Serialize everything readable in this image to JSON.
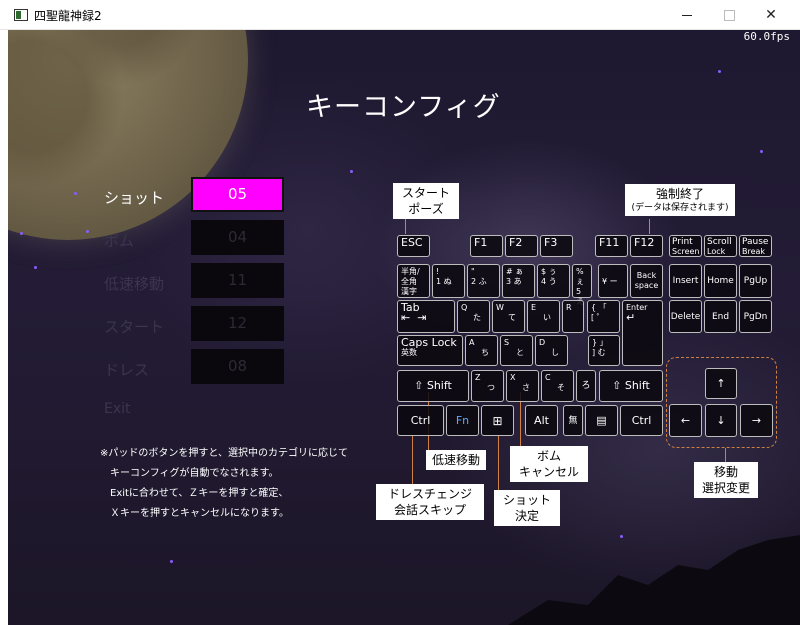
{
  "window": {
    "title": "四聖龍神録2"
  },
  "hud": {
    "fps": "60.0fps"
  },
  "page": {
    "title": "キーコンフィグ"
  },
  "menu": {
    "items": [
      {
        "label": "ショット",
        "value": "05",
        "active": true
      },
      {
        "label": "ボム",
        "value": "04",
        "active": false
      },
      {
        "label": "低速移動",
        "value": "11",
        "active": false
      },
      {
        "label": "スタート",
        "value": "12",
        "active": false
      },
      {
        "label": "ドレス",
        "value": "08",
        "active": false
      }
    ],
    "exit_label": "Exit"
  },
  "note": {
    "lines": [
      "※パッドのボタンを押すと、選択中のカテゴリに応じて",
      "　キーコンフィグが自動でなされます。",
      "　Exitに合わせて、Ｚキーを押すと確定、",
      "　Ｘキーを押すとキャンセルになります。"
    ]
  },
  "keyboard": {
    "esc": "ESC",
    "f1": "F1",
    "f2": "F2",
    "f3": "F3",
    "f11": "F11",
    "f12": "F12",
    "print": "Print",
    "print2": "Screen",
    "scroll": "Scroll",
    "scroll2": "Lock",
    "pause": "Pause",
    "pause2": "Break",
    "hankaku": "半角/",
    "zenkaku": "全角",
    "kanji": "漢字",
    "k1a": "!",
    "k1b": "1 ぬ",
    "k2a": "\"",
    "k2b": "2 ふ",
    "k3a": "# ぁ",
    "k3b": "3 あ",
    "k4a": "$ ぅ",
    "k4b": "4 う",
    "k5a": "% ぇ",
    "k5b": "5 え",
    "yen": "¥ ー",
    "backspace1": "Back",
    "backspace2": "space",
    "insert": "Insert",
    "home": "Home",
    "pgup": "PgUp",
    "tab": "Tab",
    "q1": "Q",
    "q2": "た",
    "w1": "W",
    "w2": "て",
    "e1": "E",
    "e2": "い",
    "r1": "R",
    "br1": "{ 「",
    "br2": "[ ゜",
    "enter": "Enter",
    "delete": "Delete",
    "end": "End",
    "pgdn": "PgDn",
    "caps": "Caps Lock",
    "eisu": "英数",
    "a1": "A",
    "a2": "ち",
    "s1": "S",
    "s2": "と",
    "d1": "D",
    "d2": "し",
    "br3": "} 」",
    "br4": "] む",
    "shift": "Shift",
    "z1": "Z",
    "z2": "つ",
    "x1": "X",
    "x2": "さ",
    "c1": "C",
    "c2": "そ",
    "ro": "ろ",
    "up": "↑",
    "left": "←",
    "down": "↓",
    "right": "→",
    "ctrl": "Ctrl",
    "fn": "Fn",
    "alt": "Alt",
    "muhenkan": "無"
  },
  "callouts": {
    "start_pause": [
      "スタート",
      "ポーズ"
    ],
    "force_quit": "強制終了",
    "force_quit_note": "(データは保存されます)",
    "slow_move": "低速移動",
    "bomb_cancel": [
      "ボム",
      "キャンセル"
    ],
    "dress_skip": [
      "ドレスチェンジ",
      "会話スキップ"
    ],
    "shot_confirm": [
      "ショット",
      "決定"
    ],
    "move_select": [
      "移動",
      "選択変更"
    ]
  },
  "colors": {
    "highlight": "#ff00ff",
    "leader": "#d08040",
    "fn_key": "#5ea6ff"
  }
}
